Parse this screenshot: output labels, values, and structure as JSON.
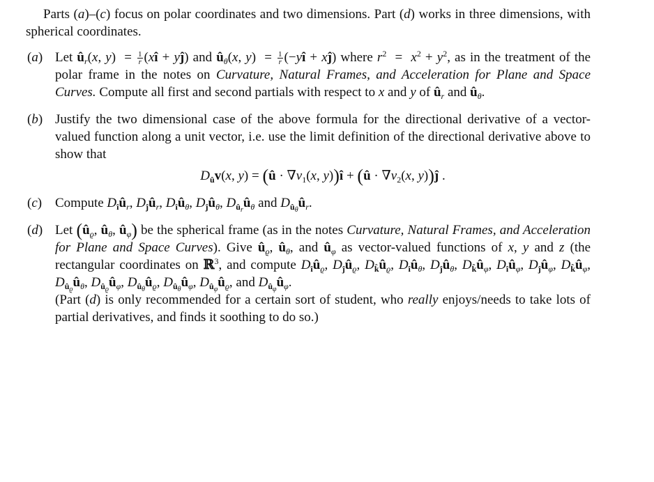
{
  "document": {
    "intro": "Parts (a)–(c) focus on polar coordinates and two dimensions. Part (d) works in three dimensions, with spherical coordinates.",
    "parts": [
      {
        "label": "a",
        "text_1": "Let",
        "formula_ur_lhs": "û_r(x, y) =",
        "formula_ur_frac": "1/r",
        "formula_ur_rhs": "(xî + yĵ)",
        "text_and": "and",
        "formula_utheta_lhs": "û_θ(x, y) =",
        "formula_utheta_frac": "1/r",
        "formula_utheta_rhs": "(−yî + xĵ)",
        "text_where": "where",
        "formula_r": "r² = x² + y²",
        "text_2": ", as in the treatment of the polar frame in the notes on",
        "notes_title": "Curvature, Natural Frames, and Acceleration for Plane and Space Curves.",
        "text_3": "Compute all first and second partials with respect to x and y of û_r and û_θ."
      },
      {
        "label": "b",
        "text": "Justify the two dimensional case of the above formula for the directional derivative of a vector-valued function along a unit vector, i.e. use the limit definition of the directional derivative above to show that",
        "display_formula": "D_û v(x, y) = (û · ∇v₁(x, y)) î + (û · ∇v₂(x, y)) ĵ ."
      },
      {
        "label": "c",
        "text": "Compute D_î û_r, D_ĵ û_r, D_î û_θ, D_ĵ û_θ, D_{û_r} û_θ and D_{û_θ} û_r."
      },
      {
        "label": "d",
        "text_1": "Let (û_ϱ, û_θ, û_φ) be the spherical frame (as in the notes",
        "notes_title": "Curvature, Natural Frames, and Acceleration for Plane and Space Curves",
        "text_2": "). Give û_ϱ, û_θ, and û_φ as vector-valued functions of x, y and z (the rectangular coordinates on ℝ³, and compute D_î û_ϱ, D_ĵ û_ϱ, D_k̂ û_ϱ, D_î û_θ, D_ĵ û_θ, D_k̂ û_φ, D_î û_φ, D_ĵ û_φ, D_k̂ û_φ, D_{û_ϱ} û_θ, D_{û_ϱ} û_φ, D_{û_θ} û_ϱ, D_{û_θ} û_φ, D_{û_φ} û_ϱ, and D_{û_φ} û_φ.",
        "note": "(Part (d) is only recommended for a certain sort of student, who really enjoys/needs to take lots of partial derivatives, and finds it soothing to do so.)"
      }
    ]
  },
  "strings": {
    "intro_a": "Parts (",
    "intro_b": ")–(",
    "intro_c": ") focus on polar coordinates and two dimensions. Part (",
    "intro_d": ") works in three dimensions, with spherical coordinates.",
    "let": "Let",
    "and": "and",
    "where": "where",
    "as_in": ", as in the treatment of the polar frame in the notes on",
    "notes_a": "Curvature, Natural Frames, and Acceleration for Plane and Space Curves.",
    "compute_a": "Compute all first and second partials with respect to",
    "wrt_and": "and",
    "of": "of",
    "b_text": "Justify the two dimensional case of the above formula for the directional derivative of a vector-valued function along a unit vector, i.e. use the limit definition of the directional derivative above to show that",
    "compute": "Compute",
    "d_frame": "be the spherical frame (as in the notes",
    "notes_d": "Curvature, Natural Frames, and Acceleration for Plane and Space Curves",
    "d_give": "). Give",
    "d_vv": "as vector-valued functions of",
    "d_rect": "(the rectangular coordinates on",
    "d_compute": ", and compute",
    "d_note_1": "(Part (",
    "d_note_2": ") is only recommended for a certain sort of student, who",
    "d_note_really": "really",
    "d_note_3": "enjoys/needs to take lots of partial derivatives, and finds it soothing to do so.)"
  }
}
